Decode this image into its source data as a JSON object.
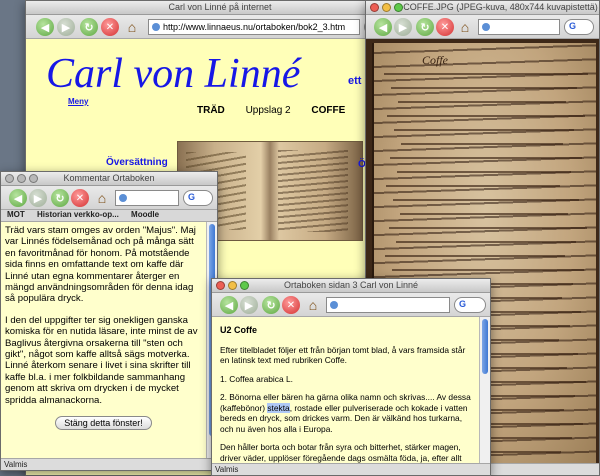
{
  "main_window": {
    "title": "Carl von Linné på internet",
    "url": "http://www.linnaeus.nu/ortaboken/bok2_3.htm",
    "search_glyph": "G",
    "heading": "Carl von Linné",
    "heading_cut": "ett",
    "menu_link": "Meny",
    "nav": [
      "TRÄD",
      "Uppslag 2",
      "COFFE"
    ],
    "translate_link": "Översättning",
    "side_cut": "Ö"
  },
  "image_window": {
    "title": "COFFE.JPG (JPEG-kuva, 480x744 kuvapistettä)",
    "search_glyph": "G",
    "manuscript_head": "Coffe"
  },
  "comment_window": {
    "title": "Kommentar Ortaboken",
    "bookmarks": [
      "MOT",
      "Historian verkko-op...",
      "Moodle"
    ],
    "search_glyph": "G",
    "paragraphs": [
      "Träd vars stam omges av orden \"Majus\". Maj var Linnés födelsemånad och på många sätt en favoritmånad för honom. På motstående sida finns en omfattande text om kaffe där Linné utan egna kommentarer återger en mängd användningsområden för denna idag så populära dryck.",
      "I den del uppgifter ter sig onekligen ganska komiska för en nutida läsare, inte minst de av Baglivus återgivna orsakerna till \"sten och gikt\", något som kaffe alltså sägs motverka. Linné återkom senare i livet i sina skrifter till kaffe bl.a. i mer folkbildande sammanhang genom att skriva om drycken i de mycket spridda almanackorna."
    ],
    "close_button": "Stäng detta fönster!",
    "status": "Valmis"
  },
  "ortaboken_window": {
    "title": "Ortaboken sidan 3 Carl von Linné",
    "search_glyph": "G",
    "heading": "U2 Coffe",
    "p1": "Efter titelbladet följer ett från början tomt blad, å vars framsida står en latinsk text med rubriken Coffe.",
    "p2": "1. Coffea arabica L.",
    "p3_a": "2. Bönorna eller bären ha gärna olika namn och skrivas.... Av dessa (kaffebönor) ",
    "p3_hl": "stekta",
    "p3_b": ", rostade eller pulveriserade och kokade i vatten bereds en dryck, som drickes varm. Den är välkänd hos turkarna, och nu även hos alla i Europa.",
    "p4": "Den håller borta och botar från syra och bitterhet, stärker magen, driver väder, upplöser föregående dags osmälta föda, ja, efter allt för mycket vindrickande minskar den dess verkningar och skingrar ruset, håller en vaken, ger öppning, är bra vid obstruktioner av urin, menses,",
    "status": "Valmis"
  },
  "colors": {
    "page_yellow": "#ffffb8",
    "popup_yellow": "#ffffcc",
    "link_blue": "#1717e6",
    "highlight": "#aec8f5"
  }
}
